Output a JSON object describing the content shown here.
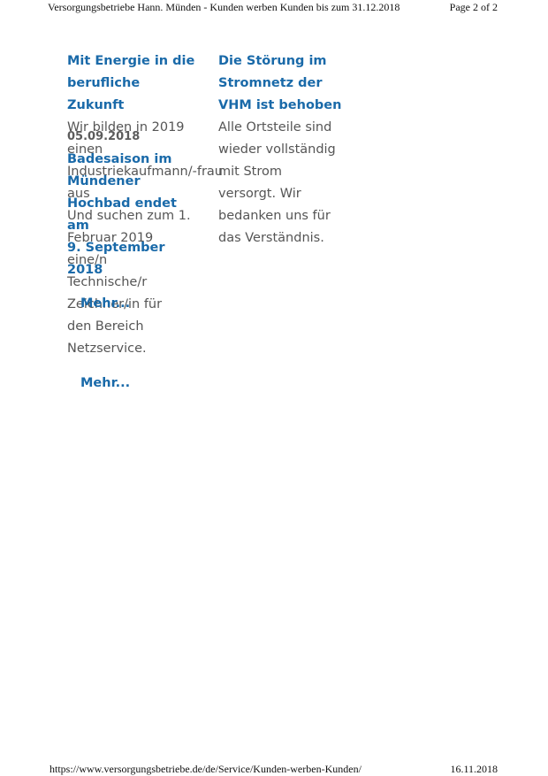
{
  "print_header": {
    "title": "Versorgungsbetriebe Hann. Münden - Kunden werben Kunden bis zum 31.12.2018",
    "page": "Page 2 of 2"
  },
  "print_footer": {
    "url": "https://www.versorgungsbetriebe.de/de/Service/Kunden-werben-Kunden/",
    "date": "16.11.2018"
  },
  "articles": [
    {
      "title_lines": [
        "Mit Energie in die",
        "berufliche",
        "Zukunft"
      ],
      "body_lines": [
        "Wir bilden in 2019",
        "einen",
        "Industriekaufmann/-frau",
        "aus",
        "Und suchen zum 1.",
        "Februar 2019",
        "eine/n",
        "Technische/r",
        "Zeichner/in für",
        "den Bereich",
        "Netzservice."
      ],
      "more_label": "Mehr..."
    },
    {
      "title_lines": [
        "Die Störung im",
        "Stromnetz der",
        "VHM ist behoben"
      ],
      "body_lines": [
        "Alle Ortsteile sind",
        "wieder vollständig",
        "mit Strom",
        "versorgt. Wir",
        "bedanken uns für",
        "das Verständnis."
      ]
    },
    {
      "date": "05.09.2018",
      "title_lines": [
        "Badesaison im",
        "Mündener",
        "Hochbad endet",
        "am",
        "9. September",
        "2018"
      ],
      "more_label": "Mehr..."
    }
  ]
}
